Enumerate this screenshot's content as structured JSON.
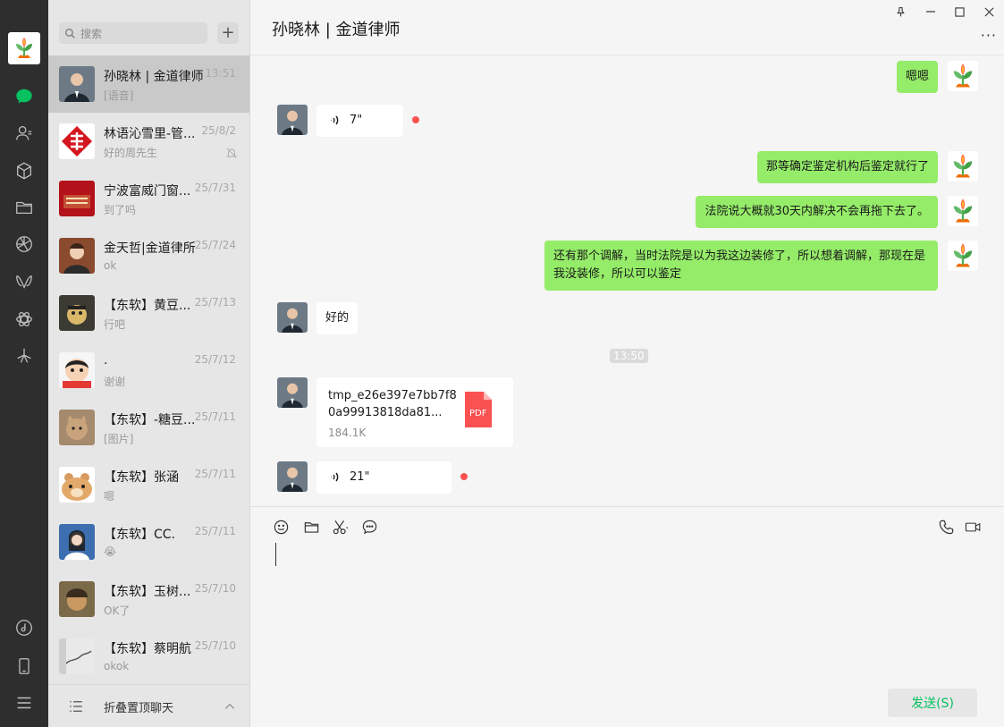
{
  "sidebar": {
    "icons": [
      "chat-icon",
      "contacts-icon",
      "favorites-icon",
      "files-icon",
      "moments-icon",
      "channels-icon",
      "mini-programs-icon",
      "search-discover-icon",
      "music-icon",
      "phone-icon",
      "menu-icon"
    ]
  },
  "search": {
    "placeholder": "搜索"
  },
  "chats": [
    {
      "name": "孙晓林 | 金道律师",
      "time": "13:51",
      "preview": "[语音]",
      "active": true
    },
    {
      "name": "林语沁雪里-管...",
      "time": "25/8/2",
      "preview": "好的周先生",
      "muted": true
    },
    {
      "name": "宁波富威门窗...",
      "time": "25/7/31",
      "preview": "到了吗"
    },
    {
      "name": "金天哲|金道律所",
      "time": "25/7/24",
      "preview": "ok"
    },
    {
      "name": "【东软】黄豆...",
      "time": "25/7/13",
      "preview": "行吧"
    },
    {
      "name": ".",
      "time": "25/7/12",
      "preview": "谢谢"
    },
    {
      "name": "【东软】-糖豆...",
      "time": "25/7/11",
      "preview": "[图片]"
    },
    {
      "name": "【东软】张涵",
      "time": "25/7/11",
      "preview": "嗯"
    },
    {
      "name": "【东软】CC.",
      "time": "25/7/11",
      "preview": "😭"
    },
    {
      "name": "【东软】玉树...",
      "time": "25/7/10",
      "preview": "OK了"
    },
    {
      "name": "【东软】蔡明航",
      "time": "25/7/10",
      "preview": "okok"
    }
  ],
  "list_footer": {
    "label": "折叠置顶聊天"
  },
  "header": {
    "title": "孙晓林 | 金道律师",
    "more": "···"
  },
  "messages": [
    {
      "dir": "out",
      "text": "嗯嗯"
    },
    {
      "dir": "in",
      "type": "voice",
      "duration": "7\""
    },
    {
      "dir": "out",
      "text": "那等确定鉴定机构后鉴定就行了"
    },
    {
      "dir": "out",
      "text": "法院说大概就30天内解决不会再拖下去了。"
    },
    {
      "dir": "out",
      "text": "还有那个调解，当时法院是以为我这边装修了，所以想着调解，那现在是我没装修，所以可以鉴定"
    },
    {
      "dir": "in",
      "text": "好的"
    },
    {
      "type": "time",
      "text": "13:50"
    },
    {
      "dir": "in",
      "type": "file",
      "name": "tmp_e26e397e7bb7f80a99913818da81...",
      "size": "184.1K",
      "ext": "PDF"
    },
    {
      "dir": "in",
      "type": "voice",
      "duration": "21\""
    }
  ],
  "composer": {
    "send_label": "发送(S)"
  },
  "colors": {
    "accent": "#07c160",
    "bubble_out": "#95ec69",
    "unread": "#fa5151"
  }
}
